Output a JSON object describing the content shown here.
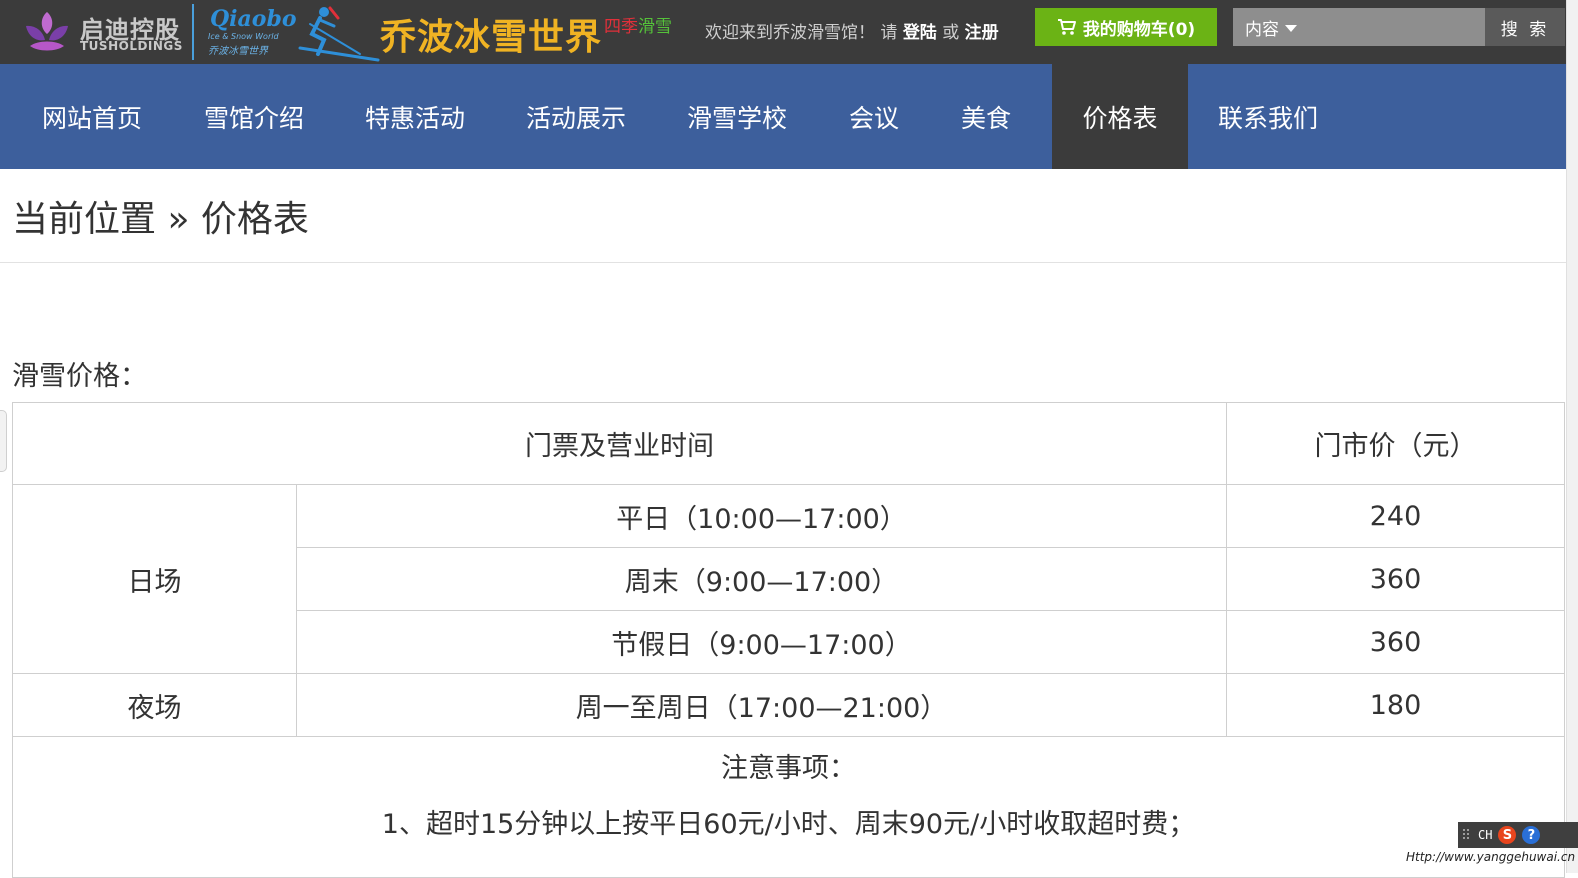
{
  "header": {
    "tus_name": "启迪控股",
    "tus_en": "TUSHOLDINGS",
    "qiaobo_script": "Qiaobo",
    "qiaobo_sub1": "Ice & Snow World",
    "qiaobo_sub2": "乔波冰雪世界",
    "brand_title": "乔波冰雪世界",
    "brand_season_red": "四季",
    "brand_season_green": "滑雪",
    "welcome_prefix": "欢迎来到乔波滑雪馆！ 请 ",
    "login_label": "登陆",
    "welcome_or": " 或 ",
    "register_label": "注册",
    "cart_label": "我的购物车(0)",
    "search_select_value": "内容",
    "search_value": "",
    "search_placeholder": "",
    "search_button_label": "搜 索"
  },
  "nav": {
    "items": [
      {
        "label": "网站首页"
      },
      {
        "label": "雪馆介绍"
      },
      {
        "label": "特惠活动"
      },
      {
        "label": "活动展示"
      },
      {
        "label": "滑雪学校"
      },
      {
        "label": "会议"
      },
      {
        "label": "美食"
      },
      {
        "label": "价格表"
      },
      {
        "label": "联系我们"
      }
    ],
    "active_label": "价格表"
  },
  "breadcrumb": "当前位置 » 价格表",
  "section_title": "滑雪价格：",
  "table": {
    "header_left": "门票及营业时间",
    "header_right": "门市价（元）",
    "day_label": "日场",
    "night_label": "夜场",
    "rows": [
      {
        "time": "平日（10:00—17:00）",
        "price": "240"
      },
      {
        "time": "周末（9:00—17:00）",
        "price": "360"
      },
      {
        "time": "节假日（9:00—17:00）",
        "price": "360"
      },
      {
        "time": "周一至周日（17:00—21:00）",
        "price": "180"
      }
    ],
    "notes_title": "注意事项：",
    "notes": [
      "1、超时15分钟以上按平日60元/小时、周末90元/小时收取超时费；"
    ]
  },
  "ime": {
    "lang": "CH",
    "s_icon": "S",
    "help_icon": "?"
  },
  "watermark": "Http://www.yanggehuwai.cn",
  "colors": {
    "topbar": "#3b3b3b",
    "nav": "#3d5f9c",
    "nav_active": "#3b3b3b",
    "cart": "#6bb315",
    "brand": "#f0b323"
  }
}
